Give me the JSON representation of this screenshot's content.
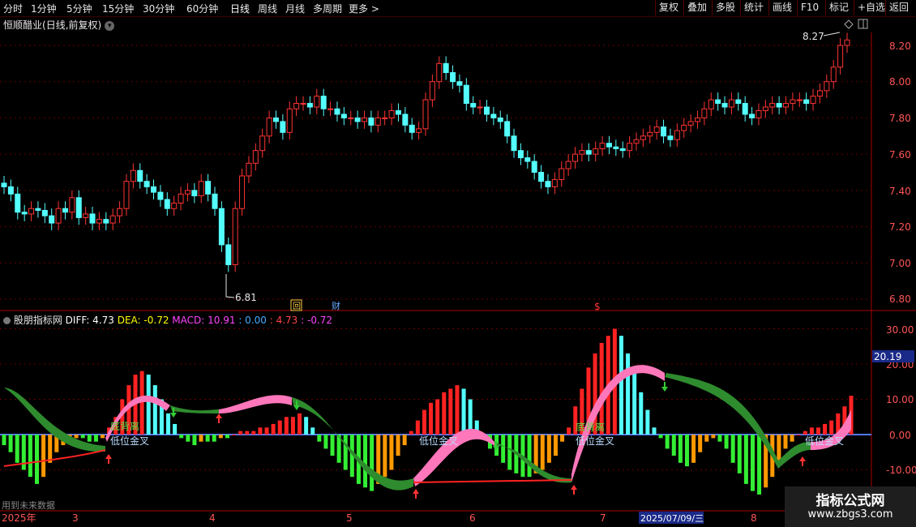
{
  "toolbar": {
    "periods": [
      "分时",
      "1分钟",
      "5分钟",
      "15分钟",
      "30分钟",
      "60分钟",
      "日线",
      "周线",
      "月线",
      "多周期",
      "更多 >"
    ],
    "active_period": "日线",
    "buttons": [
      "复权",
      "叠加",
      "多股",
      "统计",
      "画线",
      "F10",
      "标记",
      "+自选",
      "返回"
    ]
  },
  "main_chart": {
    "stock_name": "恒顺醋业",
    "mode": "(日线,前复权)",
    "y_ticks": [
      "8.20",
      "8.00",
      "7.80",
      "7.60",
      "7.40",
      "7.20",
      "7.00",
      "6.80"
    ],
    "high_label": "8.27",
    "low_label": "6.81",
    "markers": [
      {
        "text": "回",
        "color": "#ffcc44"
      },
      {
        "text": "财",
        "color": "#66aaff"
      },
      {
        "text": "$",
        "color": "#ff3333"
      }
    ]
  },
  "indicator": {
    "name": "股朋指标网",
    "diff_label": "DIFF: 4.73",
    "dea_label": "DEA: -0.72",
    "macd_label": "MACD: 10.91",
    "extra": [
      ": 0.00",
      ": 4.73",
      ": -0.72"
    ],
    "y_ticks": [
      "30.00",
      "20.00",
      "10.00",
      "0.00",
      "-10.00"
    ],
    "current_value": "20.19",
    "signal_labels": [
      "底背离",
      "低位金叉",
      "低位金叉",
      "底背离",
      "低位金叉",
      "低位金叉"
    ]
  },
  "date_axis": {
    "labels": [
      "2025年",
      "3",
      "4",
      "5",
      "6",
      "7",
      "2025/07/09/三",
      "8"
    ]
  },
  "footer_note": "用到未来数据",
  "watermark": {
    "main": "指标公式网",
    "url": "www.zbgs3.com"
  },
  "colors": {
    "up": "#ff3333",
    "down": "#54ffff",
    "green": "#2e8b2e",
    "pink": "#ff77bb",
    "orange": "#ff9900",
    "axis": "#aa0000"
  }
}
